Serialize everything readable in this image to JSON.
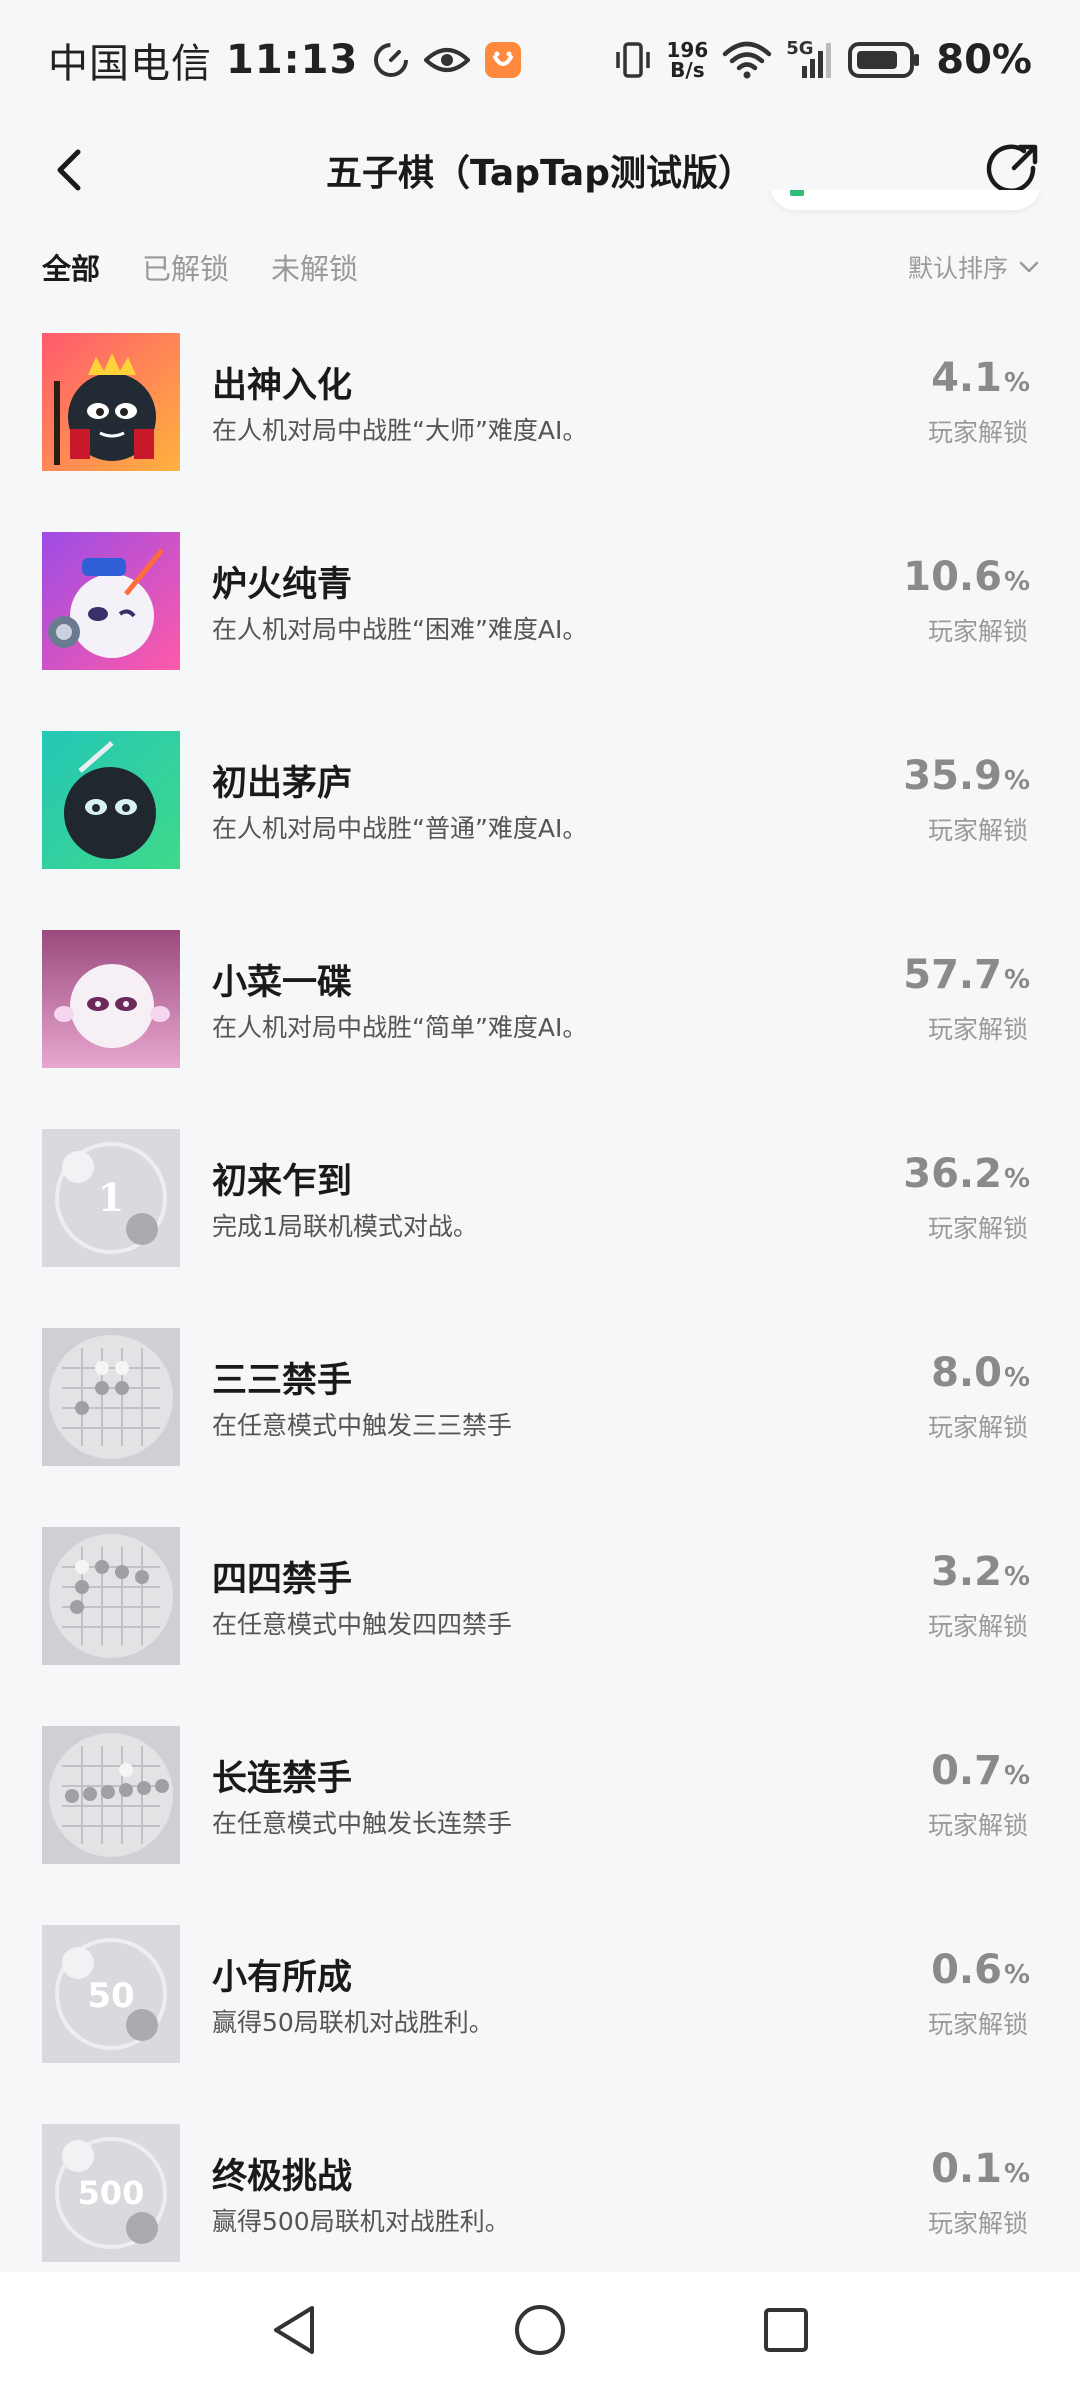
{
  "status_bar": {
    "carrier": "中国电信",
    "time": "11:13",
    "net_speed_value": "196",
    "net_speed_unit": "B/s",
    "signal_label": "5G",
    "battery": "80%"
  },
  "nav": {
    "title": "五子棋（TapTap测试版）"
  },
  "filters": {
    "tabs": [
      "全部",
      "已解锁",
      "未解锁"
    ],
    "active_index": 0,
    "sort_label": "默认排序"
  },
  "achievements": [
    {
      "title": "出神入化",
      "desc": "在人机对局中战胜“大师”难度AI。",
      "pct": "4.1",
      "unit": "%",
      "label": "玩家解锁",
      "icon": "black-ghost-crown-icon",
      "unlocked": true
    },
    {
      "title": "炉火纯青",
      "desc": "在人机对局中战胜“困难”难度AI。",
      "pct": "10.6",
      "unit": "%",
      "label": "玩家解锁",
      "icon": "white-ghost-sword-icon",
      "unlocked": true
    },
    {
      "title": "初出茅庐",
      "desc": "在人机对局中战胜“普通”难度AI。",
      "pct": "35.9",
      "unit": "%",
      "label": "玩家解锁",
      "icon": "black-ghost-teal-icon",
      "unlocked": true
    },
    {
      "title": "小菜一碟",
      "desc": "在人机对局中战胜“简单”难度AI。",
      "pct": "57.7",
      "unit": "%",
      "label": "玩家解锁",
      "icon": "white-ghost-pink-icon",
      "unlocked": true
    },
    {
      "title": "初来乍到",
      "desc": "完成1局联机模式对战。",
      "pct": "36.2",
      "unit": "%",
      "label": "玩家解锁",
      "icon": "online-1-icon",
      "unlocked": false,
      "badge_number": "1"
    },
    {
      "title": "三三禁手",
      "desc": "在任意模式中触发三三禁手",
      "pct": "8.0",
      "unit": "%",
      "label": "玩家解锁",
      "icon": "board-33-icon",
      "unlocked": false
    },
    {
      "title": "四四禁手",
      "desc": "在任意模式中触发四四禁手",
      "pct": "3.2",
      "unit": "%",
      "label": "玩家解锁",
      "icon": "board-44-icon",
      "unlocked": false
    },
    {
      "title": "长连禁手",
      "desc": "在任意模式中触发长连禁手",
      "pct": "0.7",
      "unit": "%",
      "label": "玩家解锁",
      "icon": "board-long-icon",
      "unlocked": false
    },
    {
      "title": "小有所成",
      "desc": "赢得50局联机对战胜利。",
      "pct": "0.6",
      "unit": "%",
      "label": "玩家解锁",
      "icon": "online-50-icon",
      "unlocked": false,
      "badge_number": "50"
    },
    {
      "title": "终极挑战",
      "desc": "赢得500局联机对战胜利。",
      "pct": "0.1",
      "unit": "%",
      "label": "玩家解锁",
      "icon": "online-500-icon",
      "unlocked": false,
      "badge_number": "500"
    }
  ],
  "colors": {
    "background": "#f6f7f9",
    "title_text": "#1a1a1a",
    "muted_text": "#9a9a9a",
    "percent_text": "#8a8a8a"
  }
}
